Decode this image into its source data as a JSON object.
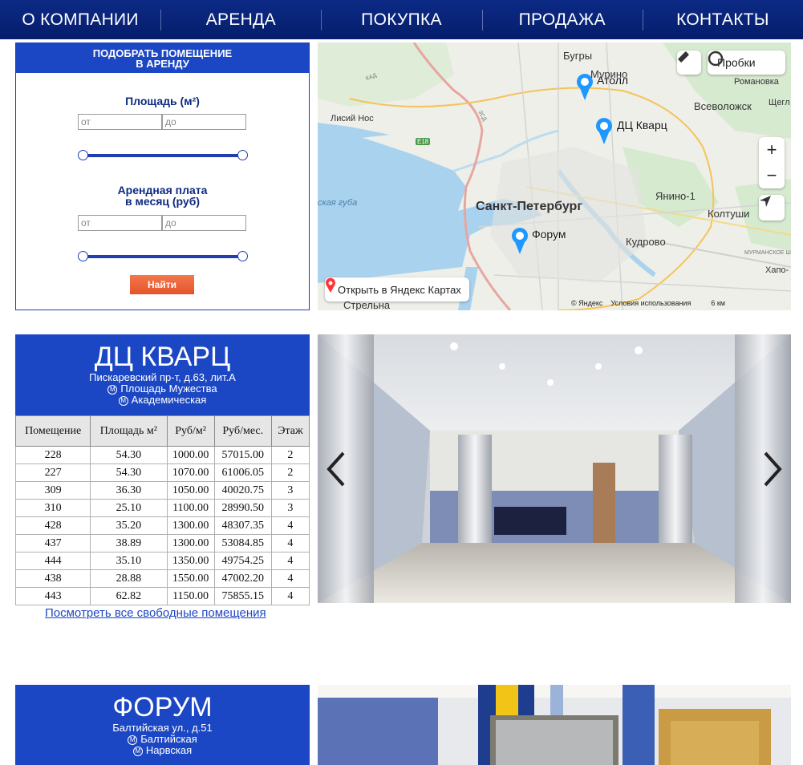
{
  "nav": [
    "О КОМПАНИИ",
    "АРЕНДА",
    "ПОКУПКА",
    "ПРОДАЖА",
    "КОНТАКТЫ"
  ],
  "filter": {
    "title_line1": "ПОДОБРАТЬ ПОМЕЩЕНИЕ",
    "title_line2": "В АРЕНДУ",
    "area_label": "Площадь (м²)",
    "rent_label_line1": "Арендная плата",
    "rent_label_line2": "в месяц (руб)",
    "from_placeholder": "от",
    "to_placeholder": "до",
    "find_button": "Найти"
  },
  "map": {
    "city": "Санкт-Петербург",
    "places": [
      "Бугры",
      "Мурино",
      "Романовка",
      "Всеволожск",
      "Щегл",
      "Лисий Нос",
      "Янино-1",
      "Колтуши",
      "Кудрово",
      "Хапо-",
      "Стрельна",
      "ская губа"
    ],
    "roads": [
      "КАД",
      "ЗСД",
      "E18",
      "МУРМАНСКОЕ Ш"
    ],
    "pins": [
      "Атолл",
      "ДЦ Кварц",
      "Форум"
    ],
    "traffic_button": "Пробки",
    "open_yandex": "Открыть в Яндекс Картах",
    "copyright": "© Яндекс",
    "terms": "Условия использования",
    "scale": "6 км"
  },
  "building1": {
    "name": "ДЦ КВАРЦ",
    "address": "Пискаревский пр-т, д.63, лит.А",
    "metro": [
      "Площадь Мужества",
      "Академическая"
    ],
    "table": {
      "headers": [
        "Помещение",
        "Площадь м²",
        "Руб/м²",
        "Руб/мес.",
        "Этаж"
      ],
      "rows": [
        [
          "228",
          "54.30",
          "1000.00",
          "57015.00",
          "2"
        ],
        [
          "227",
          "54.30",
          "1070.00",
          "61006.05",
          "2"
        ],
        [
          "309",
          "36.30",
          "1050.00",
          "40020.75",
          "3"
        ],
        [
          "310",
          "25.10",
          "1100.00",
          "28990.50",
          "3"
        ],
        [
          "428",
          "35.20",
          "1300.00",
          "48307.35",
          "4"
        ],
        [
          "437",
          "38.89",
          "1300.00",
          "53084.85",
          "4"
        ],
        [
          "444",
          "35.10",
          "1350.00",
          "49754.25",
          "4"
        ],
        [
          "438",
          "28.88",
          "1550.00",
          "47002.20",
          "4"
        ],
        [
          "443",
          "62.82",
          "1150.00",
          "75855.15",
          "4"
        ]
      ]
    },
    "see_all": "Посмотреть все свободные помещения"
  },
  "building2": {
    "name": "ФОРУМ",
    "address": "Балтийская ул., д.51",
    "metro": [
      "Балтийская",
      "Нарвская"
    ]
  },
  "colors": {
    "nav": "#0a2580",
    "brand_blue": "#1c47c4",
    "button": "#ec6a3e"
  },
  "icons": [
    "ruler-icon",
    "traffic-icon",
    "zoom-in-icon",
    "zoom-out-icon",
    "geolocation-icon",
    "map-pin-icon",
    "metro-icon",
    "arrow-left-icon",
    "arrow-right-icon"
  ]
}
